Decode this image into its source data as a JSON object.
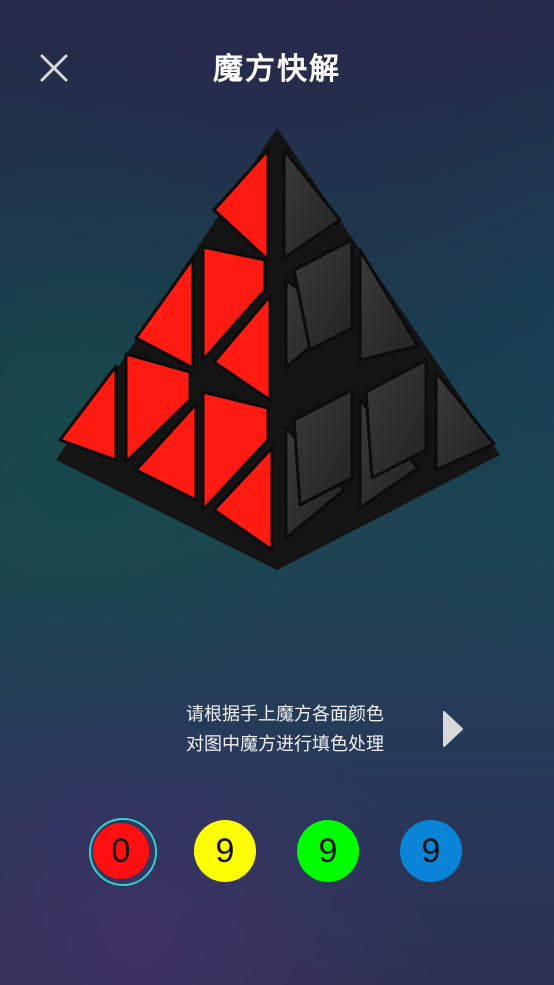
{
  "header": {
    "title": "魔方快解",
    "close_icon": "close-icon"
  },
  "instructions": {
    "line1": "请根据手上魔方各面颜色",
    "line2": "对图中魔方进行填色处理",
    "next_icon": "play-arrow-icon"
  },
  "puzzle": {
    "left_face_color": "#ff1a12",
    "right_face_color": "#2a2a2a",
    "frame_color": "#111111"
  },
  "palette": {
    "selected_index": 0,
    "colors": [
      {
        "color": "#ff0f0f",
        "count": "0"
      },
      {
        "color": "#ffff00",
        "count": "9"
      },
      {
        "color": "#00ff00",
        "count": "9"
      },
      {
        "color": "#0a84d6",
        "count": "9"
      }
    ]
  }
}
